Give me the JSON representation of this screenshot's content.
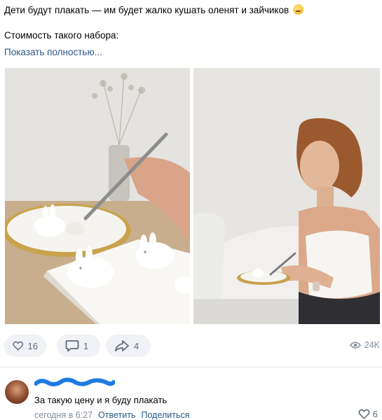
{
  "post": {
    "line1": "Дети будут плакать — им будет жалко кушать оленят и зайчиков",
    "line2": "Стоимость такого набора:",
    "show_more": "Показать полностью..."
  },
  "actions": {
    "likes": "16",
    "comments": "1",
    "shares": "4",
    "views": "24K"
  },
  "comment": {
    "text": "За такую цену и я буду плакать",
    "time": "сегодня в 6:27",
    "reply": "Ответить",
    "share": "Поделиться",
    "likes": "6"
  },
  "colors": {
    "link": "#2a5885",
    "icon": "#5f6b7a",
    "button_bg": "#f0f2f5",
    "scribble": "#1c7ae0"
  }
}
